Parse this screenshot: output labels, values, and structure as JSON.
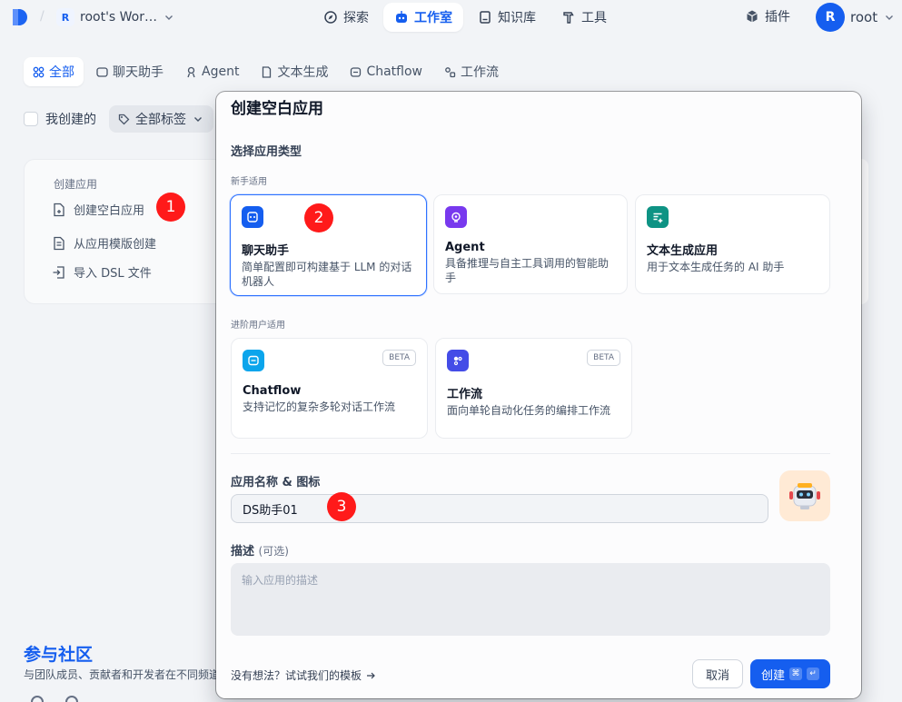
{
  "header": {
    "workspace_initial": "R",
    "workspace_name": "root's Wor…",
    "nav": [
      {
        "label": "探索",
        "icon": "compass-icon"
      },
      {
        "label": "工作室",
        "icon": "robot-icon"
      },
      {
        "label": "知识库",
        "icon": "book-icon"
      },
      {
        "label": "工具",
        "icon": "hammer-icon"
      }
    ],
    "plugins_label": "插件",
    "user_initial": "R",
    "user_name": "root"
  },
  "tabs": [
    {
      "label": "全部",
      "icon": "grid-icon"
    },
    {
      "label": "聊天助手",
      "icon": "chat-icon"
    },
    {
      "label": "Agent",
      "icon": "agent-icon"
    },
    {
      "label": "文本生成",
      "icon": "doc-icon"
    },
    {
      "label": "Chatflow",
      "icon": "chatflow-icon"
    },
    {
      "label": "工作流",
      "icon": "workflow-icon"
    }
  ],
  "filters": {
    "mine_label": "我创建的",
    "tags_label": "全部标签"
  },
  "create_card": {
    "title": "创建应用",
    "items": [
      {
        "label": "创建空白应用",
        "icon": "file-plus-icon"
      },
      {
        "label": "从应用模版创建",
        "icon": "file-template-icon"
      },
      {
        "label": "导入 DSL 文件",
        "icon": "import-icon"
      }
    ]
  },
  "community": {
    "title": "参与社区",
    "desc": "与团队成员、贡献者和开发者在不同频道中交流"
  },
  "badges": [
    "1",
    "2",
    "3"
  ],
  "modal": {
    "title": "创建空白应用",
    "type_section": "选择应用类型",
    "beginner_label": "新手适用",
    "advanced_label": "进阶用户适用",
    "types": [
      {
        "name": "聊天助手",
        "desc": "简单配置即可构建基于 LLM 的对话机器人",
        "color": "#155eef"
      },
      {
        "name": "Agent",
        "desc": "具备推理与自主工具调用的智能助手",
        "color": "#7839ee"
      },
      {
        "name": "文本生成应用",
        "desc": "用于文本生成任务的 AI 助手",
        "color": "#0e9384"
      },
      {
        "name": "Chatflow",
        "desc": "支持记忆的复杂多轮对话工作流",
        "color": "#0ba5ec",
        "beta": "BETA"
      },
      {
        "name": "工作流",
        "desc": "面向单轮自动化任务的编排工作流",
        "color": "#444ce7",
        "beta": "BETA"
      }
    ],
    "name_label": "应用名称 & 图标",
    "name_value": "DS助手01",
    "desc_label": "描述",
    "desc_optional": "(可选)",
    "desc_placeholder": "输入应用的描述",
    "template_link": "没有想法？试试我们的模板",
    "cancel": "取消",
    "create": "创建",
    "create_keys": [
      "⌘",
      "↵"
    ]
  }
}
